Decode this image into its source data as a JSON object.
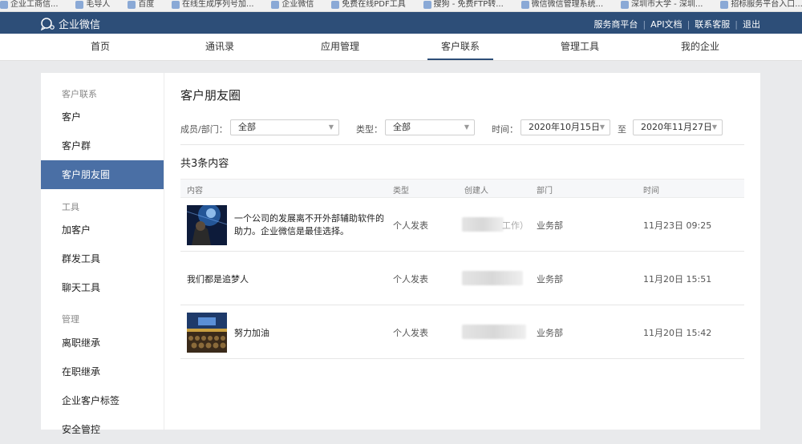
{
  "bookmarks": [
    "企业工商信...",
    "毛导人",
    "百度",
    "在线生成序列号加...",
    "企业微信",
    "免费在线PDF工具",
    "搜狗 - 免费FTP转...",
    "微信微信管理系统...",
    "深圳市大学 - 深圳...",
    "招标服务平台入口..."
  ],
  "topbar": {
    "logo_text": "企业微信",
    "links": [
      "服务商平台",
      "API文档",
      "联系客服",
      "退出"
    ],
    "separator": "|"
  },
  "nav": {
    "tabs": [
      "首页",
      "通讯录",
      "应用管理",
      "客户联系",
      "管理工具",
      "我的企业"
    ],
    "active_index": 3
  },
  "sidebar": {
    "groups": [
      {
        "label": "客户联系",
        "items": [
          "客户",
          "客户群",
          "客户朋友圈"
        ]
      },
      {
        "label": "工具",
        "items": [
          "加客户",
          "群发工具",
          "聊天工具"
        ]
      },
      {
        "label": "管理",
        "items": [
          "离职继承",
          "在职继承",
          "企业客户标签",
          "安全管控"
        ]
      }
    ],
    "active_item": "客户朋友圈"
  },
  "main": {
    "title": "客户朋友圈",
    "filters": {
      "member_label": "成员/部门：",
      "member_value": "全部",
      "type_label": "类型：",
      "type_value": "全部",
      "time_label": "时间：",
      "date_from": "2020年10月15日",
      "to_label": "至",
      "date_to": "2020年11月27日"
    },
    "count_text": "共3条内容",
    "columns": [
      "内容",
      "类型",
      "创建人",
      "部门",
      "时间"
    ],
    "rows": [
      {
        "content": "一个公司的发展离不开外部辅助软件的助力。企业微信是最佳选择。",
        "has_image": true,
        "image": "space-scene",
        "type": "个人发表",
        "creator_visible": "工作）",
        "department": "业务部",
        "time": "11月23日 09:25"
      },
      {
        "content": "我们都是追梦人",
        "has_image": false,
        "type": "个人发表",
        "creator_visible": "",
        "department": "业务部",
        "time": "11月20日 15:51"
      },
      {
        "content": "努力加油",
        "has_image": true,
        "image": "auditorium-scene",
        "type": "个人发表",
        "creator_visible": "",
        "department": "业务部",
        "time": "11月20日 15:42"
      }
    ]
  },
  "colors": {
    "topbar": "#2d4e78",
    "sidebar_active": "#4a6fa5"
  }
}
